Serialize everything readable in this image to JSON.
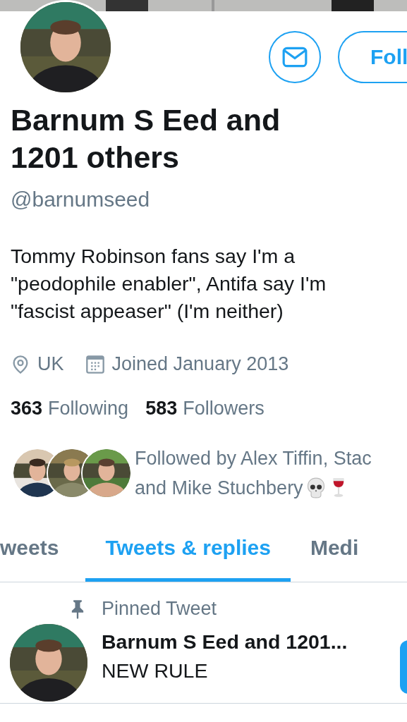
{
  "profile": {
    "name": "Barnum S Eed and 1201 others",
    "handle": "@barnumseed",
    "bio_lines": [
      "Tommy Robinson fans say I'm a",
      "\"peodophile enabler\", Antifa say I'm",
      "\"fascist appeaser\" (I'm neither)"
    ],
    "location": "UK",
    "joined": "Joined January 2013",
    "following_count": "363",
    "following_label": "Following",
    "followers_count": "583",
    "followers_label": "Followers",
    "followed_by_lines": [
      "Followed by Alex Tiffin, Stac",
      "and Mike Stuchbery"
    ]
  },
  "actions": {
    "follow_button": "Foll"
  },
  "tabs": [
    {
      "label": "weets",
      "selected": false
    },
    {
      "label": "Tweets & replies",
      "selected": true
    },
    {
      "label": "Medi",
      "selected": false
    }
  ],
  "pinned": {
    "label": "Pinned Tweet",
    "author": "Barnum S Eed and 1201...",
    "text": "NEW RULE"
  }
}
